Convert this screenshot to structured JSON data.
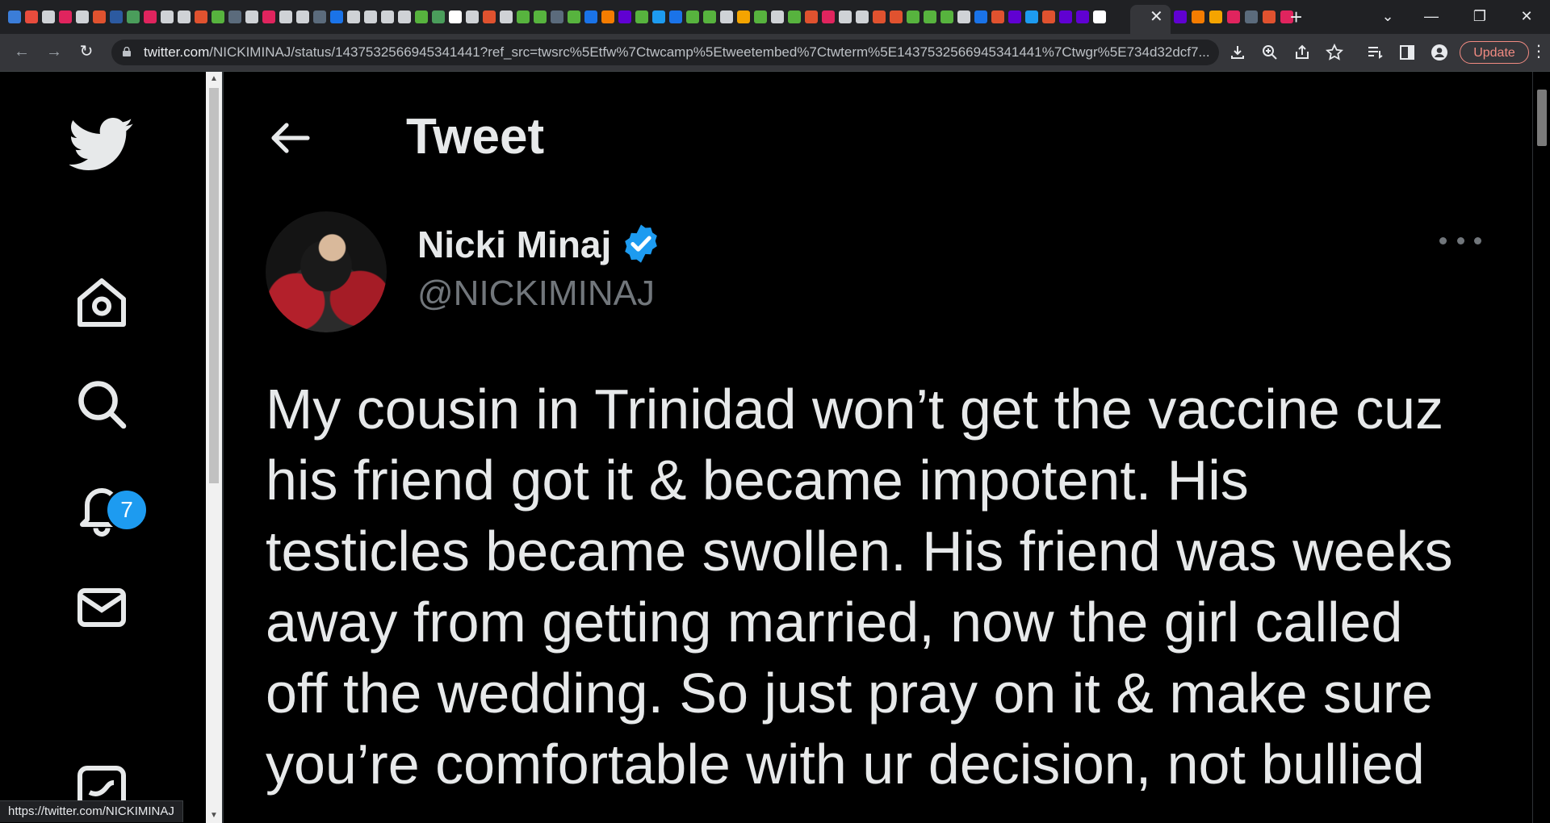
{
  "browser": {
    "tab_favicon_colors": [
      "#3b7dd8",
      "#e84c3d",
      "#cfd2d6",
      "#e0245e",
      "#cfd2d6",
      "#e0522f",
      "#2c5aa0",
      "#4a9d5b",
      "#e0245e",
      "#cfd2d6",
      "#cfd2d6",
      "#e0522f",
      "#57b33e",
      "#5b6b7c",
      "#cfd2d6",
      "#e0245e",
      "#cfd2d6",
      "#cfd2d6",
      "#5b6b7c",
      "#1a73e8",
      "#cfd2d6",
      "#cfd2d6",
      "#cfd2d6",
      "#cfd2d6",
      "#57b33e",
      "#4a9d5b",
      "#ffffff",
      "#cfd2d6",
      "#e0522f",
      "#cfd2d6",
      "#57b33e",
      "#57b33e",
      "#5b6b7c",
      "#57b33e",
      "#1a73e8",
      "#f57c00",
      "#6001d2",
      "#57b33e",
      "#1d9bf0",
      "#1a73e8",
      "#57b33e",
      "#57b33e",
      "#cfd2d6",
      "#f4a400",
      "#57b33e",
      "#cfd2d6",
      "#57b33e",
      "#e0522f",
      "#e0245e",
      "#cfd2d6",
      "#cfd2d6",
      "#e0522f",
      "#e0522f",
      "#57b33e",
      "#57b33e",
      "#57b33e",
      "#cfd2d6",
      "#1a73e8",
      "#e0522f",
      "#6001d2",
      "#1d9bf0",
      "#e0522f",
      "#6001d2",
      "#6001d2",
      "#ffffff"
    ],
    "tab_favicon_colors_right": [
      "#6001d2",
      "#f57c00",
      "#f4a400",
      "#e0245e",
      "#5b6b7c",
      "#e0522f",
      "#e0245e"
    ],
    "tab_close_glyph": "✕",
    "new_tab_glyph": "+",
    "window_controls": [
      "⌄",
      "—",
      "❐",
      "✕"
    ],
    "url_host": "twitter.com",
    "url_path": "/NICKIMINAJ/status/1437532566945341441?ref_src=twsrc%5Etfw%7Ctwcamp%5Etweetembed%7Ctwterm%5E1437532566945341441%7Ctwgr%5E734d32dcf7...",
    "update_label": "Update",
    "status_url": "https://twitter.com/NICKIMINAJ"
  },
  "sidebar": {
    "notification_count": "7",
    "icons": [
      "twitter-logo-icon",
      "home-icon",
      "search-icon",
      "notifications-bell-icon",
      "messages-envelope-icon",
      "twitter-bookmark-icon"
    ],
    "brand_color": "#e7e9ea",
    "badge_color": "#1d9bf0"
  },
  "header": {
    "title": "Tweet"
  },
  "tweet": {
    "display_name": "Nicki Minaj",
    "handle": "@NICKIMINAJ",
    "verified": true,
    "verified_color": "#1d9bf0",
    "text_lines": [
      "My cousin in Trinidad won’t get the vaccine cuz",
      "his friend got it & became impotent. His",
      "testicles became swollen. His friend was weeks",
      "away from getting married, now the girl called",
      "off the wedding. So just pray on it & make sure",
      "you’re comfortable with ur decision, not bullied"
    ]
  }
}
